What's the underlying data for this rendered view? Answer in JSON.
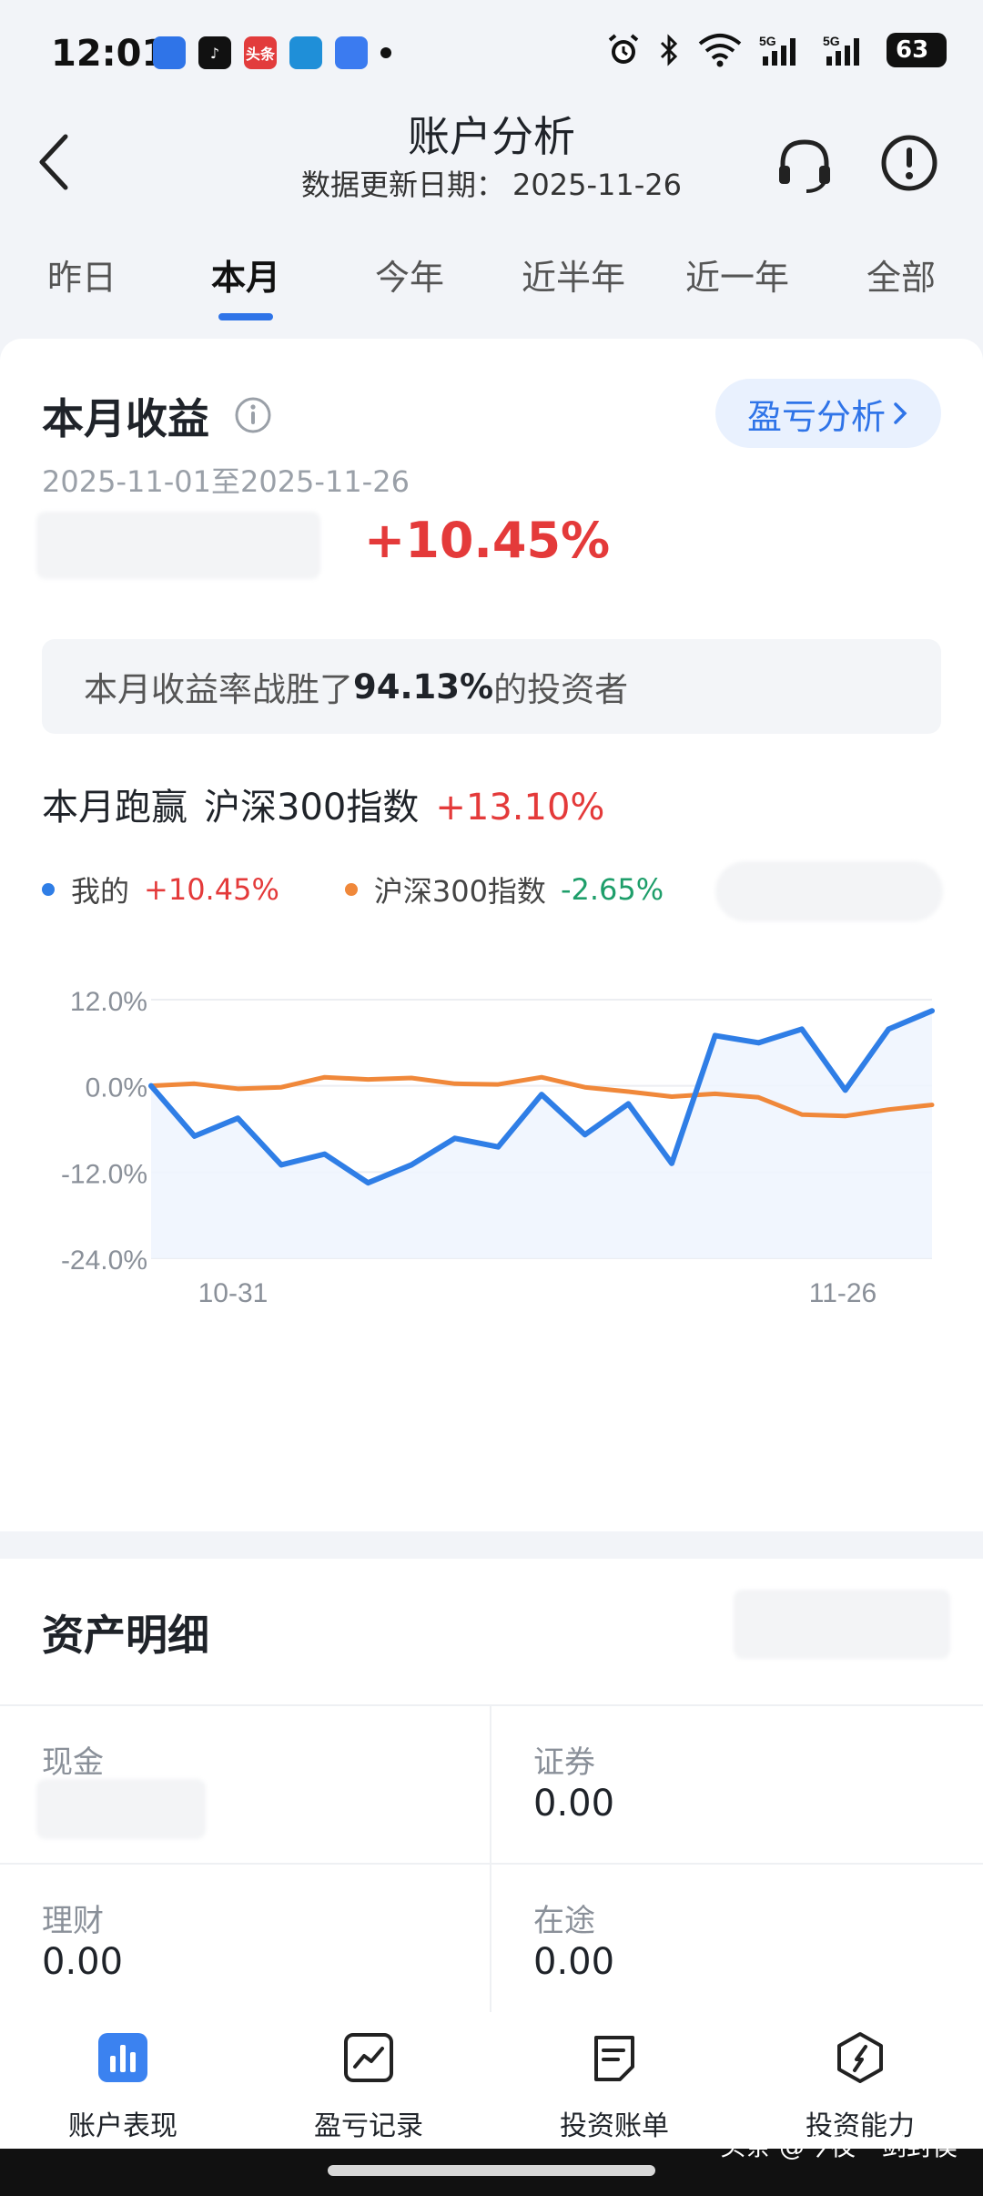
{
  "status_bar": {
    "time": "12:01",
    "app_icons": [
      {
        "name": "app-blue-icon",
        "label": "",
        "color": "#2f74e8"
      },
      {
        "name": "tiktok-icon",
        "label": "♪",
        "color": "#111111"
      },
      {
        "name": "toutiao-icon",
        "label": "头条",
        "color": "#e23c3c"
      },
      {
        "name": "app-teal-icon",
        "label": "",
        "color": "#1f8fd8"
      },
      {
        "name": "files-icon",
        "label": "",
        "color": "#3b7bf0"
      }
    ],
    "battery": "63"
  },
  "header": {
    "title": "账户分析",
    "update_label": "数据更新日期：",
    "update_date": "2025-11-26"
  },
  "tabs": [
    {
      "label": "昨日",
      "active": false
    },
    {
      "label": "本月",
      "active": true
    },
    {
      "label": "今年",
      "active": false
    },
    {
      "label": "近半年",
      "active": false
    },
    {
      "label": "近一年",
      "active": false
    },
    {
      "label": "全部",
      "active": false
    }
  ],
  "summary": {
    "title": "本月收益",
    "pl_button": "盈亏分析",
    "date_range": "2025-11-01至2025-11-26",
    "return_pct": "+10.45%",
    "beat_prefix": "本月收益率战胜了",
    "beat_value": "94.13%",
    "beat_suffix": "的投资者"
  },
  "comparison": {
    "label": "本月跑赢",
    "index_name": "沪深300指数",
    "diff": "+13.10%",
    "legend_mine_name": "我的",
    "legend_mine_value": "+10.45%",
    "legend_index_name": "沪深300指数",
    "legend_index_value": "-2.65%"
  },
  "colors": {
    "mine": "#2f7ee6",
    "index": "#f0883a",
    "accent": "#2f74e8",
    "positive": "#e43a3a",
    "negative": "#1e9e6a"
  },
  "chart_data": {
    "type": "line",
    "x_tick_labels": [
      "10-31",
      "11-26"
    ],
    "ylim": [
      -24,
      12
    ],
    "y_ticks": [
      12,
      0,
      -12,
      -24
    ],
    "y_tick_labels": [
      "12.0%",
      "0.0%",
      "-12.0%",
      "-24.0%"
    ],
    "grid": true,
    "series": [
      {
        "name": "我的",
        "values": [
          0,
          -7,
          -4.5,
          -11,
          -9.5,
          -13.5,
          -11,
          -7.3,
          -8.5,
          -1.2,
          -6.8,
          -2.5,
          -10.8,
          7,
          6,
          7.9,
          -0.6,
          7.9,
          10.45
        ]
      },
      {
        "name": "沪深300指数",
        "values": [
          0,
          0.3,
          -0.4,
          -0.2,
          1.2,
          0.9,
          1.1,
          0.3,
          0.2,
          1.2,
          -0.2,
          -0.8,
          -1.5,
          -1.1,
          -1.6,
          -4,
          -4.2,
          -3.3,
          -2.65
        ]
      }
    ]
  },
  "assets": {
    "title": "资产明细",
    "items": [
      {
        "label": "现金",
        "value": ""
      },
      {
        "label": "证券",
        "value": "0.00"
      },
      {
        "label": "理财",
        "value": "0.00"
      },
      {
        "label": "在途",
        "value": "0.00"
      }
    ]
  },
  "nav": [
    {
      "label": "账户表现",
      "icon": "bar-chart-icon",
      "active": true
    },
    {
      "label": "盈亏记录",
      "icon": "trend-chart-icon",
      "active": false
    },
    {
      "label": "投资账单",
      "icon": "bill-icon",
      "active": false
    },
    {
      "label": "投资能力",
      "icon": "compass-icon",
      "active": false
    }
  ],
  "footer": {
    "watermark": "头条 @今夜一剑封侯"
  }
}
